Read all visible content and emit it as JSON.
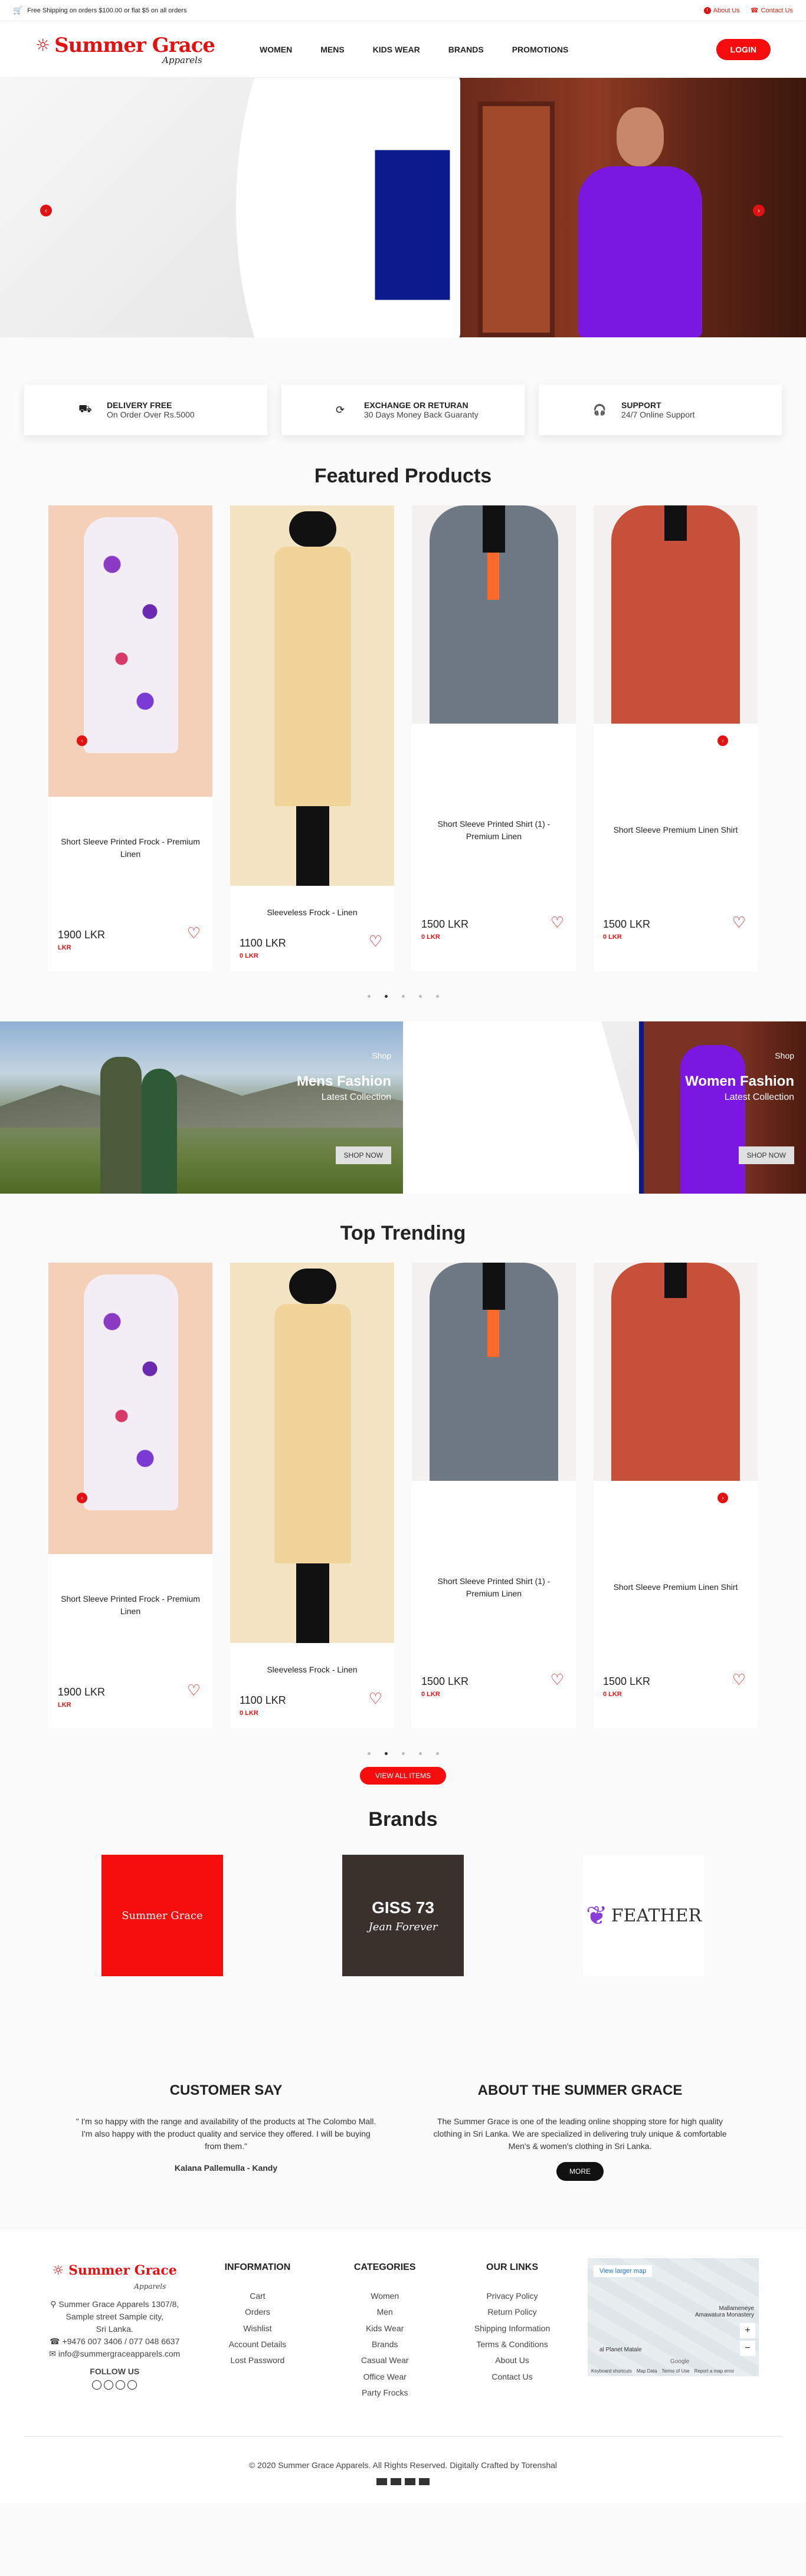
{
  "topbar": {
    "promo": "Free Shipping on orders $100.00 or flat $5 on all orders",
    "about": "About Us",
    "contact": "Contact Us"
  },
  "header": {
    "brand": "Summer Grace",
    "brand_sub": "Apparels",
    "nav": [
      "WOMEN",
      "MENS",
      "KIDS WEAR",
      "BRANDS",
      "PROMOTIONS"
    ],
    "login": "LOGIN"
  },
  "features": [
    {
      "title": "DELIVERY FREE",
      "sub": "On Order Over Rs.5000",
      "icon": "truck-icon"
    },
    {
      "title": "EXCHANGE OR RETURAN",
      "sub": "30 Days Money Back Guaranty",
      "icon": "refresh-icon"
    },
    {
      "title": "SUPPORT",
      "sub": "24/7 Online Support",
      "icon": "headphones-icon"
    }
  ],
  "featured": {
    "title": "Featured Products",
    "products": [
      {
        "name": "Short Sleeve Printed Frock - Premium Linen",
        "price": "1900 LKR",
        "small": "LKR"
      },
      {
        "name": "Sleeveless Frock - Linen",
        "price": "1100 LKR",
        "small": "0 LKR"
      },
      {
        "name": "Short Sleeve Printed Shirt (1) - Premium Linen",
        "price": "1500 LKR",
        "small": "0 LKR"
      },
      {
        "name": "Short Sleeve Premium Linen Shirt",
        "price": "1500 LKR",
        "small": "0 LKR"
      }
    ]
  },
  "banners": [
    {
      "small": "Shop",
      "title": "Mens Fashion",
      "sub": "Latest Collection",
      "btn": "SHOP NOW"
    },
    {
      "small": "Shop",
      "title": "Women Fashion",
      "sub": "Latest Collection",
      "btn": "SHOP NOW"
    }
  ],
  "trending": {
    "title": "Top Trending",
    "products": [
      {
        "name": "Short Sleeve Printed Frock - Premium Linen",
        "price": "1900 LKR",
        "small": "LKR"
      },
      {
        "name": "Sleeveless Frock - Linen",
        "price": "1100 LKR",
        "small": "0 LKR"
      },
      {
        "name": "Short Sleeve Printed Shirt (1) - Premium Linen",
        "price": "1500 LKR",
        "small": "0 LKR"
      },
      {
        "name": "Short Sleeve Premium Linen Shirt",
        "price": "1500 LKR",
        "small": "0 LKR"
      }
    ],
    "view_all": "VIEW ALL ITEMS"
  },
  "brands": {
    "title": "Brands",
    "items": [
      "Summer Grace",
      "GISS 73",
      "Jean Forever",
      "FEATHER"
    ]
  },
  "customer": {
    "title": "CUSTOMER SAY",
    "quote": "\" I'm so happy with the range and availability of the products at The Colombo Mall. I'm also happy with the product quality and service they offered. I will be buying from them.\"",
    "author": "Kalana Pallemulla - Kandy"
  },
  "about": {
    "title": "ABOUT THE SUMMER GRACE",
    "text": "The Summer Grace is one of the leading online shopping store for high quality clothing in Sri Lanka. We are specialized in delivering truly unique & comfortable Men's & women's clothing in Sri Lanka.",
    "btn": "MORE"
  },
  "footer": {
    "address": [
      "Summer Grace Apparels 1307/8,",
      "Sample street Sample city,",
      "Sri Lanka."
    ],
    "phone": "+9476 007 3406 / 077 048 6637",
    "email": "info@summergraceapparels.com",
    "follow": "FOLLOW US",
    "info_title": "INFORMATION",
    "info": [
      "Cart",
      "Orders",
      "Wishlist",
      "Account Details",
      "Lost Password"
    ],
    "cat_title": "CATEGORIES",
    "cats": [
      "Women",
      "Men",
      "Kids Wear",
      "Brands",
      "Casual Wear",
      "Office Wear",
      "Party Frocks"
    ],
    "links_title": "OUR LINKS",
    "links": [
      "Privacy Policy",
      "Return Policy",
      "Shipping Information",
      "Terms & Conditions",
      "About Us",
      "Contact Us"
    ],
    "map_link": "View larger map",
    "map_labels": [
      "Mallameneye",
      "Amawatura Monastery",
      "al Planet Matale",
      "Google",
      "Keyboard shortcuts",
      "Map Data",
      "Terms of Use",
      "Report a map error"
    ],
    "copyright": "© 2020 Summer Grace Apparels. All Rights Reserved. Digitally Crafted by Torenshal"
  },
  "colors": {
    "accent": "#e31212",
    "dark": "#111111"
  }
}
